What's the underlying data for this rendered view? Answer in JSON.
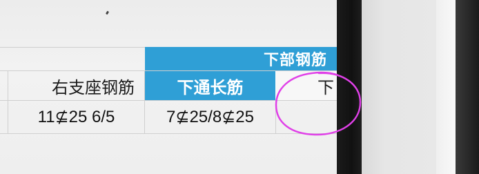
{
  "table": {
    "group_header": "下部钢筋",
    "columns": {
      "support_right": "右支座钢筋",
      "bottom_through": "下通长筋",
      "next_partial": "下"
    },
    "rows": [
      {
        "support_right": "11⊈25 6/5",
        "bottom_through": "7⊈25/8⊈25",
        "next_partial": ""
      }
    ]
  },
  "colors": {
    "header_blue": "#2f9fd6",
    "annotation": "#e040e8"
  }
}
